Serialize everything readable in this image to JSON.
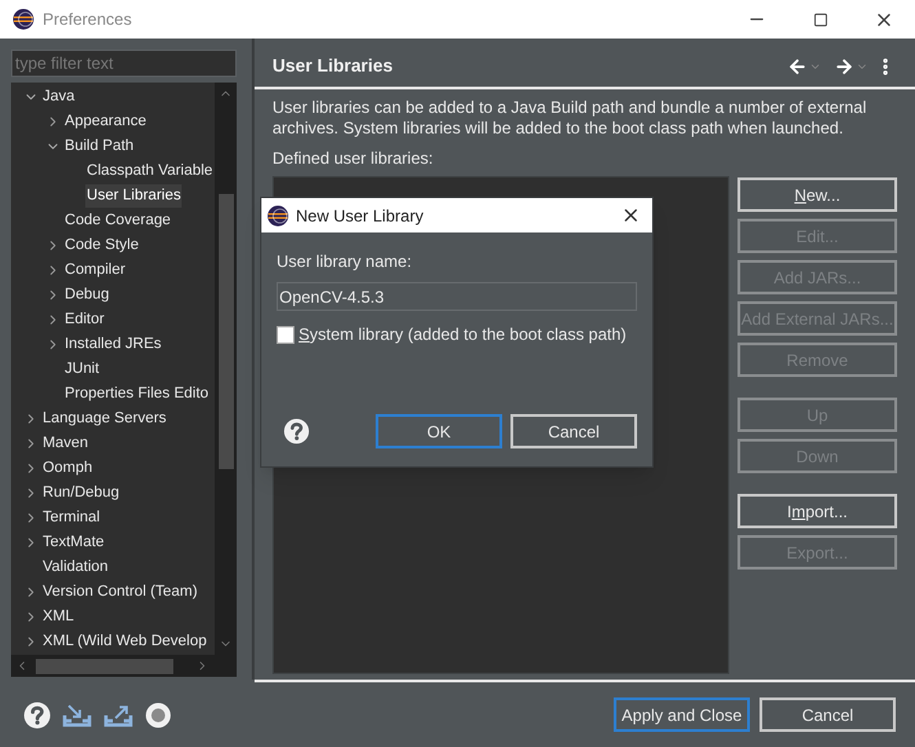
{
  "window": {
    "title": "Preferences"
  },
  "filter": {
    "placeholder": "type filter text"
  },
  "tree": [
    {
      "label": "Java",
      "kind": "folder",
      "expanded": true,
      "selected": false,
      "children": [
        {
          "label": "Appearance",
          "kind": "folder",
          "expanded": false,
          "selected": false
        },
        {
          "label": "Build Path",
          "kind": "folder",
          "expanded": true,
          "selected": false,
          "children": [
            {
              "label": "Classpath Variable",
              "kind": "leaf",
              "selected": false
            },
            {
              "label": "User Libraries",
              "kind": "leaf",
              "selected": true
            }
          ]
        },
        {
          "label": "Code Coverage",
          "kind": "leaf",
          "selected": false
        },
        {
          "label": "Code Style",
          "kind": "folder",
          "expanded": false,
          "selected": false
        },
        {
          "label": "Compiler",
          "kind": "folder",
          "expanded": false,
          "selected": false
        },
        {
          "label": "Debug",
          "kind": "folder",
          "expanded": false,
          "selected": false
        },
        {
          "label": "Editor",
          "kind": "folder",
          "expanded": false,
          "selected": false
        },
        {
          "label": "Installed JREs",
          "kind": "folder",
          "expanded": false,
          "selected": false
        },
        {
          "label": "JUnit",
          "kind": "leaf",
          "selected": false
        },
        {
          "label": "Properties Files Edito",
          "kind": "leaf",
          "selected": false
        }
      ]
    },
    {
      "label": "Language Servers",
      "kind": "folder",
      "expanded": false,
      "selected": false
    },
    {
      "label": "Maven",
      "kind": "folder",
      "expanded": false,
      "selected": false
    },
    {
      "label": "Oomph",
      "kind": "folder",
      "expanded": false,
      "selected": false
    },
    {
      "label": "Run/Debug",
      "kind": "folder",
      "expanded": false,
      "selected": false
    },
    {
      "label": "Terminal",
      "kind": "folder",
      "expanded": false,
      "selected": false
    },
    {
      "label": "TextMate",
      "kind": "folder",
      "expanded": false,
      "selected": false
    },
    {
      "label": "Validation",
      "kind": "leaf",
      "selected": false
    },
    {
      "label": "Version Control (Team)",
      "kind": "folder",
      "expanded": false,
      "selected": false
    },
    {
      "label": "XML",
      "kind": "folder",
      "expanded": false,
      "selected": false
    },
    {
      "label": "XML (Wild Web Develop",
      "kind": "folder",
      "expanded": false,
      "selected": false
    }
  ],
  "page": {
    "title": "User Libraries",
    "description": "User libraries can be added to a Java Build path and bundle a number of external archives. System libraries will be added to the boot class path when launched.",
    "list_label": "Defined user libraries:",
    "button_groups": [
      [
        {
          "key": "N",
          "post": "ew...",
          "disabled": false
        },
        {
          "label": "Edit...",
          "disabled": true
        },
        {
          "label": "Add JARs...",
          "disabled": true
        },
        {
          "label": "Add External JARs...",
          "disabled": true
        },
        {
          "label": "Remove",
          "disabled": true
        }
      ],
      [
        {
          "label": "Up",
          "disabled": true
        },
        {
          "label": "Down",
          "disabled": true
        }
      ],
      [
        {
          "pre": "I",
          "key": "m",
          "post": "port...",
          "disabled": false
        },
        {
          "label": "Export...",
          "disabled": true
        }
      ]
    ]
  },
  "footer": {
    "buttons": [
      {
        "label": "Apply and Close",
        "default": true
      },
      {
        "label": "Cancel",
        "default": false
      }
    ]
  },
  "dialog": {
    "title": "New User Library",
    "name_label": "User library name:",
    "name_value": "OpenCV-4.5.3",
    "system_checkbox": {
      "key": "S",
      "post": "ystem library (added to the boot class path)",
      "checked": false
    },
    "buttons": [
      {
        "label": "OK",
        "default": true
      },
      {
        "label": "Cancel",
        "default": false
      }
    ]
  }
}
